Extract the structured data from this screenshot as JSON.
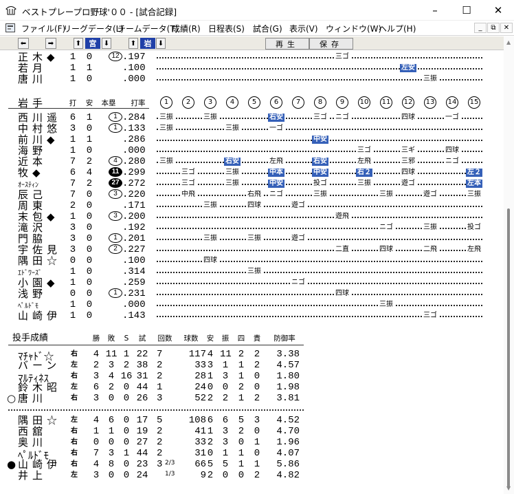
{
  "window": {
    "title": "ベストプレープロ野球'００ - [試合記録]",
    "minimize": "–",
    "maximize": "☐",
    "close": "✕"
  },
  "menu": {
    "items": [
      "ファイル(F)",
      "リーグデータ(L)",
      "チームデータ(T)",
      "成績(R)",
      "日程表(S)",
      "試合(G)",
      "表示(V)",
      "ウィンドウ(W)",
      "ヘルプ(H)"
    ],
    "child_min": "_",
    "child_restore": "⧉",
    "child_close": "✕"
  },
  "toolbar": {
    "team1": "宮",
    "team2": "岩",
    "play_label": "再生",
    "save_label": "保存"
  },
  "top_batters": [
    {
      "name": "正木◆",
      "ab": "1",
      "h": "0",
      "hr": "12",
      "hr_style": "outline",
      "avg": ".197",
      "results": [
        {
          "inning": 9,
          "text": "三ゴ",
          "hl": false
        }
      ]
    },
    {
      "name": "若月",
      "ab": "1",
      "h": "1",
      "hr": "",
      "hr_style": "",
      "avg": ".100",
      "results": [
        {
          "inning": 12,
          "text": "左安",
          "hl": true
        }
      ]
    },
    {
      "name": "唐川",
      "ab": "1",
      "h": "0",
      "hr": "",
      "hr_style": "",
      "avg": ".000",
      "results": [
        {
          "inning": 13,
          "text": "三振",
          "hl": false
        }
      ]
    }
  ],
  "team_header": {
    "team": "岩手",
    "ab": "打",
    "h": "安",
    "hr": "本塁",
    "avg": "打率",
    "innings": [
      "1",
      "2",
      "3",
      "4",
      "5",
      "6",
      "7",
      "8",
      "9",
      "10",
      "11",
      "12",
      "13",
      "14",
      "15"
    ]
  },
  "batters": [
    {
      "name": "西川遥",
      "small": false,
      "ab": "6",
      "h": "1",
      "hr": "1",
      "hr_style": "outline",
      "avg": ".284",
      "results": [
        {
          "inning": 1,
          "text": "三振",
          "hl": false
        },
        {
          "inning": 3,
          "text": "三振",
          "hl": false
        },
        {
          "inning": 6,
          "text": "右安",
          "hl": true
        },
        {
          "inning": 8,
          "text": "三ゴ",
          "hl": false
        },
        {
          "inning": 9,
          "text": "ニゴ",
          "hl": false
        },
        {
          "inning": 12,
          "text": "四球",
          "hl": false
        },
        {
          "inning": 14,
          "text": "一ゴ",
          "hl": false
        }
      ]
    },
    {
      "name": "中村悠",
      "small": false,
      "ab": "3",
      "h": "0",
      "hr": "1",
      "hr_style": "outline",
      "avg": ".133",
      "results": [
        {
          "inning": 1,
          "text": "三振",
          "hl": false
        },
        {
          "inning": 4,
          "text": "三振",
          "hl": false
        },
        {
          "inning": 6,
          "text": "一ゴ",
          "hl": false
        }
      ]
    },
    {
      "name": "前川◆",
      "small": false,
      "ab": "1",
      "h": "1",
      "hr": "",
      "hr_style": "",
      "avg": ".286",
      "results": [
        {
          "inning": 8,
          "text": "中安",
          "hl": true
        }
      ]
    },
    {
      "name": "海野",
      "small": false,
      "ab": "1",
      "h": "0",
      "hr": "",
      "hr_style": "",
      "avg": ".000",
      "results": [
        {
          "inning": 10,
          "text": "三ゴ",
          "hl": false
        },
        {
          "inning": 12,
          "text": "三ギ",
          "hl": false
        },
        {
          "inning": 14,
          "text": "四球",
          "hl": false
        }
      ]
    },
    {
      "name": "近本",
      "small": false,
      "ab": "7",
      "h": "2",
      "hr": "4",
      "hr_style": "outline",
      "avg": ".280",
      "results": [
        {
          "inning": 1,
          "text": "三振",
          "hl": false
        },
        {
          "inning": 4,
          "text": "右安",
          "hl": true
        },
        {
          "inning": 6,
          "text": "左飛",
          "hl": false
        },
        {
          "inning": 8,
          "text": "右安",
          "hl": true
        },
        {
          "inning": 10,
          "text": "左飛",
          "hl": false
        },
        {
          "inning": 12,
          "text": "三邪",
          "hl": false
        },
        {
          "inning": 14,
          "text": "ニゴ",
          "hl": false
        }
      ]
    },
    {
      "name": "牧◆",
      "small": false,
      "ab": "6",
      "h": "4",
      "hr": "11",
      "hr_style": "fill",
      "avg": ".299",
      "results": [
        {
          "inning": 2,
          "text": "三ゴ",
          "hl": false
        },
        {
          "inning": 4,
          "text": "三振",
          "hl": false
        },
        {
          "inning": 6,
          "text": "中本",
          "hl": true
        },
        {
          "inning": 8,
          "text": "中安",
          "hl": true
        },
        {
          "inning": 10,
          "text": "右２",
          "hl": true
        },
        {
          "inning": 12,
          "text": "四球",
          "hl": false
        },
        {
          "inning": 15,
          "text": "左２",
          "hl": true
        }
      ]
    },
    {
      "name": "ｵｰｽﾃｨﾝ",
      "small": true,
      "ab": "7",
      "h": "2",
      "hr": "27",
      "hr_style": "fill",
      "avg": ".272",
      "results": [
        {
          "inning": 2,
          "text": "三ゴ",
          "hl": false
        },
        {
          "inning": 4,
          "text": "三振",
          "hl": false
        },
        {
          "inning": 6,
          "text": "中安",
          "hl": true
        },
        {
          "inning": 8,
          "text": "投ゴ",
          "hl": false
        },
        {
          "inning": 10,
          "text": "三振",
          "hl": false
        },
        {
          "inning": 12,
          "text": "遊ゴ",
          "hl": false
        },
        {
          "inning": 15,
          "text": "左本",
          "hl": true
        }
      ]
    },
    {
      "name": "辰己",
      "small": false,
      "ab": "7",
      "h": "0",
      "hr": "3",
      "hr_style": "outline",
      "avg": ".220",
      "results": [
        {
          "inning": 2,
          "text": "中飛",
          "hl": false
        },
        {
          "inning": 5,
          "text": "右飛",
          "hl": false
        },
        {
          "inning": 6,
          "text": "ニゴ",
          "hl": false
        },
        {
          "inning": 8,
          "text": "三振",
          "hl": false
        },
        {
          "inning": 11,
          "text": "三振",
          "hl": false
        },
        {
          "inning": 13,
          "text": "遊ゴ",
          "hl": false
        },
        {
          "inning": 15,
          "text": "三振",
          "hl": false
        }
      ]
    },
    {
      "name": "周東",
      "small": false,
      "ab": "2",
      "h": "0",
      "hr": "",
      "hr_style": "",
      "avg": ".171",
      "results": [
        {
          "inning": 3,
          "text": "三振",
          "hl": false
        },
        {
          "inning": 5,
          "text": "四球",
          "hl": false
        },
        {
          "inning": 7,
          "text": "遊ゴ",
          "hl": false
        }
      ]
    },
    {
      "name": "末包◆",
      "small": false,
      "ab": "1",
      "h": "0",
      "hr": "3",
      "hr_style": "outline",
      "avg": ".200",
      "results": [
        {
          "inning": 9,
          "text": "遊飛",
          "hl": false
        }
      ]
    },
    {
      "name": "滝沢",
      "small": false,
      "ab": "3",
      "h": "0",
      "hr": "",
      "hr_style": "",
      "avg": ".192",
      "results": [
        {
          "inning": 11,
          "text": "ニゴ",
          "hl": false
        },
        {
          "inning": 13,
          "text": "三振",
          "hl": false
        },
        {
          "inning": 15,
          "text": "投ゴ",
          "hl": false
        }
      ]
    },
    {
      "name": "門脇",
      "small": false,
      "ab": "3",
      "h": "0",
      "hr": "1",
      "hr_style": "outline",
      "avg": ".201",
      "results": [
        {
          "inning": 3,
          "text": "三振",
          "hl": false
        },
        {
          "inning": 5,
          "text": "三振",
          "hl": false
        },
        {
          "inning": 7,
          "text": "遊ゴ",
          "hl": false
        }
      ]
    },
    {
      "name": "宇佐見",
      "small": false,
      "ab": "3",
      "h": "0",
      "hr": "2",
      "hr_style": "outline",
      "avg": ".227",
      "results": [
        {
          "inning": 9,
          "text": "二直",
          "hl": false
        },
        {
          "inning": 11,
          "text": "四球",
          "hl": false
        },
        {
          "inning": 13,
          "text": "二飛",
          "hl": false
        },
        {
          "inning": 15,
          "text": "左飛",
          "hl": false
        }
      ]
    },
    {
      "name": "隅田☆",
      "small": false,
      "ab": "0",
      "h": "0",
      "hr": "",
      "hr_style": "",
      "avg": ".100",
      "results": [
        {
          "inning": 3,
          "text": "四球",
          "hl": false
        }
      ]
    },
    {
      "name": "ｴﾄﾞﾜｰｽﾞ",
      "small": true,
      "ab": "1",
      "h": "0",
      "hr": "",
      "hr_style": "",
      "avg": ".314",
      "results": [
        {
          "inning": 5,
          "text": "三振",
          "hl": false
        }
      ]
    },
    {
      "name": "小園◆",
      "small": false,
      "ab": "1",
      "h": "0",
      "hr": "",
      "hr_style": "",
      "avg": ".259",
      "results": [
        {
          "inning": 7,
          "text": "ニゴ",
          "hl": false
        }
      ]
    },
    {
      "name": "浅野",
      "small": false,
      "ab": "0",
      "h": "0",
      "hr": "1",
      "hr_style": "outline",
      "avg": ".231",
      "results": [
        {
          "inning": 9,
          "text": "四球",
          "hl": false
        }
      ]
    },
    {
      "name": "ﾍﾟﾙﾄﾞﾓ",
      "small": true,
      "ab": "1",
      "h": "0",
      "hr": "",
      "hr_style": "",
      "avg": ".000",
      "results": [
        {
          "inning": 11,
          "text": "三振",
          "hl": false
        }
      ]
    },
    {
      "name": "山崎伊",
      "small": false,
      "ab": "1",
      "h": "0",
      "hr": "",
      "hr_style": "",
      "avg": ".143",
      "results": [
        {
          "inning": 13,
          "text": "三ゴ",
          "hl": false
        }
      ]
    }
  ],
  "pitching_header": {
    "title": "投手成績",
    "cols": [
      "勝",
      "敗",
      "S",
      "試",
      "回数",
      "球数",
      "安",
      "振",
      "四",
      "責",
      "防御率"
    ]
  },
  "pitchers_team1": [
    {
      "mark": "",
      "name": "ﾏﾁｬﾄﾞ☆",
      "small": true,
      "hand": "右",
      "w": "4",
      "l": "11",
      "s": "1",
      "g": "22",
      "ip": "7",
      "ip_frac": "",
      "np": "117",
      "h": "4",
      "k": "11",
      "bb": "2",
      "er": "2",
      "era": "3.38"
    },
    {
      "mark": "",
      "name": "バーン",
      "small": false,
      "hand": "左",
      "w": "2",
      "l": "3",
      "s": "2",
      "g": "38",
      "ip": "2",
      "ip_frac": "",
      "np": "33",
      "h": "3",
      "k": "1",
      "bb": "1",
      "er": "2",
      "era": "4.57"
    },
    {
      "mark": "",
      "name": "ﾏﾙﾃｨﾈｽ",
      "small": true,
      "hand": "右",
      "w": "3",
      "l": "4",
      "s": "16",
      "g": "31",
      "ip": "2",
      "ip_frac": "",
      "np": "28",
      "h": "1",
      "k": "3",
      "bb": "1",
      "er": "0",
      "era": "1.80"
    },
    {
      "mark": "",
      "name": "鈴木昭",
      "small": false,
      "hand": "左",
      "w": "6",
      "l": "2",
      "s": "0",
      "g": "44",
      "ip": "1",
      "ip_frac": "",
      "np": "24",
      "h": "0",
      "k": "0",
      "bb": "2",
      "er": "0",
      "era": "1.98"
    },
    {
      "mark": "○",
      "name": "唐川",
      "small": false,
      "hand": "右",
      "w": "3",
      "l": "0",
      "s": "0",
      "g": "26",
      "ip": "3",
      "ip_frac": "",
      "np": "52",
      "h": "2",
      "k": "2",
      "bb": "1",
      "er": "2",
      "era": "3.81"
    }
  ],
  "pitchers_team2": [
    {
      "mark": "",
      "name": "隅田☆",
      "small": false,
      "hand": "左",
      "w": "4",
      "l": "6",
      "s": "0",
      "g": "17",
      "ip": "5",
      "ip_frac": "",
      "np": "108",
      "h": "6",
      "k": "6",
      "bb": "5",
      "er": "3",
      "era": "4.52"
    },
    {
      "mark": "",
      "name": "西舘",
      "small": false,
      "hand": "右",
      "w": "1",
      "l": "1",
      "s": "0",
      "g": "19",
      "ip": "2",
      "ip_frac": "",
      "np": "41",
      "h": "1",
      "k": "3",
      "bb": "2",
      "er": "0",
      "era": "4.70"
    },
    {
      "mark": "",
      "name": "奥川",
      "small": false,
      "hand": "右",
      "w": "0",
      "l": "0",
      "s": "0",
      "g": "27",
      "ip": "2",
      "ip_frac": "",
      "np": "33",
      "h": "2",
      "k": "3",
      "bb": "0",
      "er": "1",
      "era": "1.96"
    },
    {
      "mark": "",
      "name": "ﾍﾟﾙﾄﾞﾓ",
      "small": true,
      "hand": "右",
      "w": "7",
      "l": "3",
      "s": "1",
      "g": "44",
      "ip": "2",
      "ip_frac": "",
      "np": "31",
      "h": "0",
      "k": "1",
      "bb": "1",
      "er": "0",
      "era": "4.07"
    },
    {
      "mark": "●",
      "name": "山崎伊",
      "small": false,
      "hand": "右",
      "w": "4",
      "l": "8",
      "s": "0",
      "g": "23",
      "ip": "3",
      "ip_frac": "2/3",
      "np": "66",
      "h": "5",
      "k": "5",
      "bb": "1",
      "er": "1",
      "era": "5.86"
    },
    {
      "mark": "",
      "name": "井上",
      "small": false,
      "hand": "左",
      "w": "3",
      "l": "0",
      "s": "0",
      "g": "24",
      "ip": "",
      "ip_frac": "1/3",
      "np": "9",
      "h": "2",
      "k": "0",
      "bb": "0",
      "er": "2",
      "era": "4.82"
    }
  ]
}
